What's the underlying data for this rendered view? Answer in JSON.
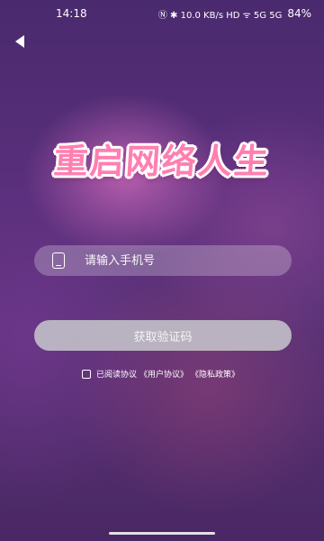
{
  "status_bar": {
    "time": "14:18",
    "signal_text": "Ⓝ ✱ 10.0 KB/s HD ᯤ 5G 5G",
    "battery": "84%"
  },
  "header": {
    "back_icon": "back-arrow-icon"
  },
  "title": "重启网络人生",
  "phone_field": {
    "placeholder": "请输入手机号",
    "icon": "phone-icon"
  },
  "get_code_button": {
    "label": "获取验证码"
  },
  "agreement": {
    "prefix": "已阅读协议",
    "user_agreement": "《用户协议》",
    "privacy_policy": "《隐私政策》"
  }
}
